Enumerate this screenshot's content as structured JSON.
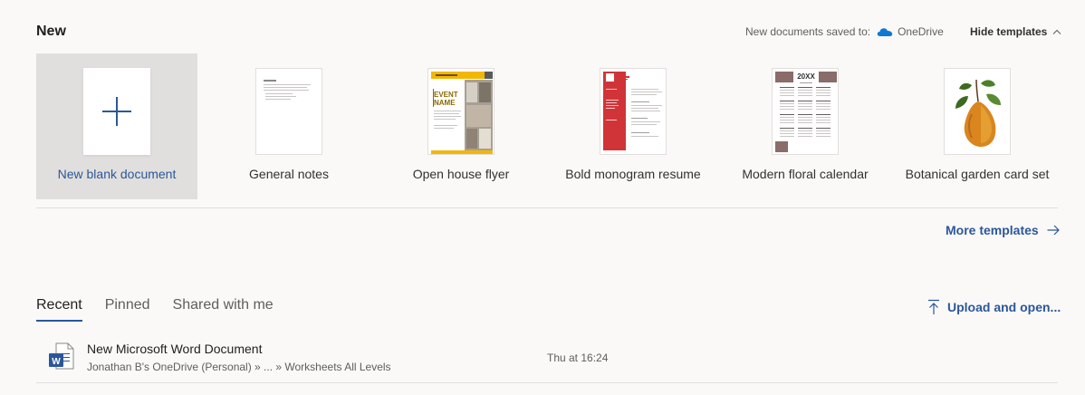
{
  "section_title": "New",
  "save_info": {
    "label": "New documents saved to:",
    "location": "OneDrive",
    "icon": "onedrive-cloud-icon"
  },
  "hide_templates_label": "Hide templates",
  "templates": [
    {
      "label": "New blank document",
      "selected": true
    },
    {
      "label": "General notes"
    },
    {
      "label": "Open house flyer",
      "thumb_text": [
        "EVENT",
        "NAME"
      ]
    },
    {
      "label": "Bold monogram resume"
    },
    {
      "label": "Modern floral calendar",
      "thumb_text": [
        "20XX"
      ]
    },
    {
      "label": "Botanical garden card set"
    }
  ],
  "more_templates_label": "More templates",
  "tabs": [
    {
      "label": "Recent",
      "active": true
    },
    {
      "label": "Pinned"
    },
    {
      "label": "Shared with me"
    }
  ],
  "upload_label": "Upload and open...",
  "recent_files": [
    {
      "name": "New Microsoft Word Document",
      "path": "Jonathan B's OneDrive (Personal) » ... » Worksheets All Levels",
      "time": "Thu at 16:24",
      "icon": "word-document-icon"
    }
  ],
  "colors": {
    "accent": "#2b579a",
    "background": "#faf9f8",
    "selected_tile": "#e1dfdd",
    "flyer_yellow": "#f2b705",
    "resume_red": "#d13438"
  }
}
